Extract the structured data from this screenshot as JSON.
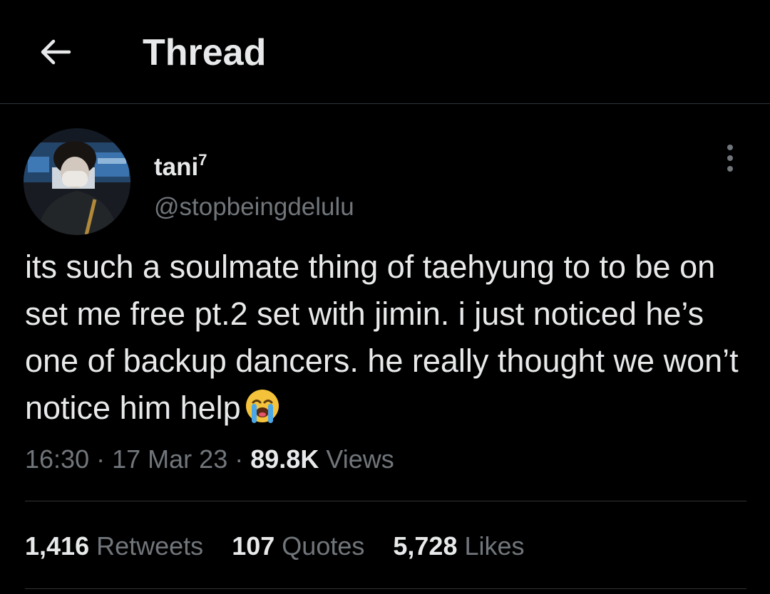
{
  "header": {
    "title": "Thread",
    "back_icon": "arrow-left-icon"
  },
  "tweet": {
    "display_name": "tani",
    "display_name_superscript": "7",
    "handle": "@stopbeingdelulu",
    "text": "its such a soulmate thing of taehyung to to be on set me free pt.2 set with jimin. i just noticed he’s one of backup dancers. he really thought we won’t notice him help",
    "emoji": "loudly-crying-face-emoji",
    "time": "16:30",
    "sep1": "·",
    "date": "17 Mar 23",
    "sep2": "·",
    "views_count": "89.8K",
    "views_label": "Views"
  },
  "stats": {
    "retweets_count": "1,416",
    "retweets_label": "Retweets",
    "quotes_count": "107",
    "quotes_label": "Quotes",
    "likes_count": "5,728",
    "likes_label": "Likes"
  },
  "colors": {
    "background": "#000000",
    "primary_text": "#e7e9ea",
    "secondary_text": "#71767b",
    "divider": "#2f3336"
  }
}
